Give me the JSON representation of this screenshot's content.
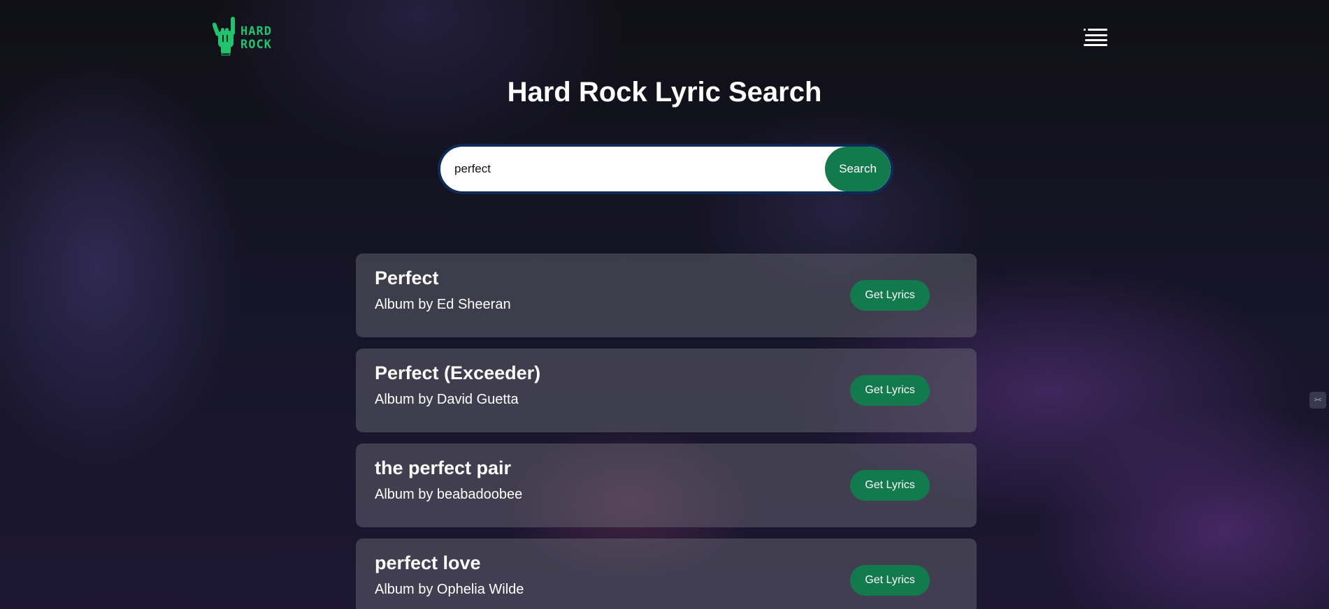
{
  "header": {
    "logo_text_line1": "HARD",
    "logo_text_line2": "ROCK",
    "logo_icon": "rock-hand-icon",
    "menu_icon": "hamburger-menu-icon"
  },
  "main": {
    "title": "Hard Rock Lyric Search"
  },
  "search": {
    "value": "perfect",
    "button_label": "Search"
  },
  "results": [
    {
      "title": "Perfect",
      "artist_line": "Album by Ed Sheeran",
      "button_label": "Get Lyrics"
    },
    {
      "title": "Perfect (Exceeder)",
      "artist_line": "Album by David Guetta",
      "button_label": "Get Lyrics"
    },
    {
      "title": "the perfect pair",
      "artist_line": "Album by beabadoobee",
      "button_label": "Get Lyrics"
    },
    {
      "title": "perfect love",
      "artist_line": "Album by Ophelia Wilde",
      "button_label": "Get Lyrics"
    }
  ],
  "colors": {
    "accent": "#137a4e",
    "logo": "#23c26e",
    "search_border": "#0e2a57"
  }
}
